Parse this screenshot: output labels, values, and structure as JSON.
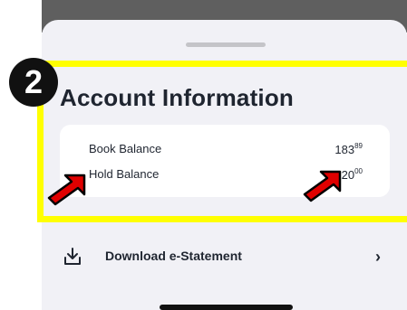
{
  "step_badge": "2",
  "account_info": {
    "title": "Account Information",
    "rows": [
      {
        "label": "Book Balance",
        "value_main": "183",
        "value_cents": "89"
      },
      {
        "label": "Hold Balance",
        "value_main": "20",
        "value_cents": "00"
      }
    ]
  },
  "download": {
    "label": "Download e-Statement",
    "icon": "download-icon",
    "chevron": "›"
  },
  "colors": {
    "highlight": "#ffff00",
    "arrow": "#e00000",
    "sheet_background": "#f1f1f6",
    "card_background": "#ffffff",
    "text": "#1f2530"
  }
}
